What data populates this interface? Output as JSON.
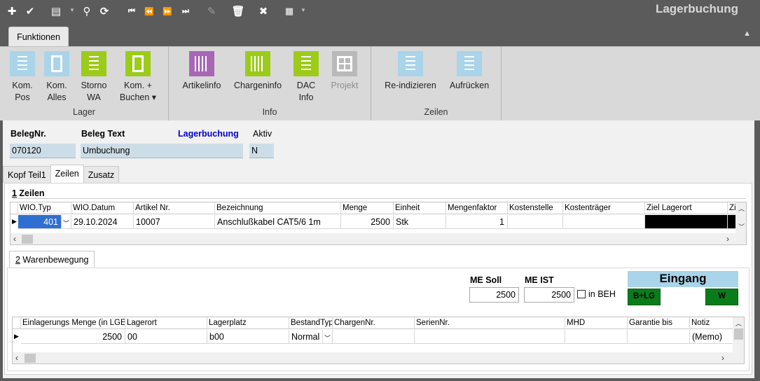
{
  "window": {
    "title": "Lagerbuchung"
  },
  "quick_toolbar": {
    "icons": [
      "plus-icon",
      "check-icon",
      "print-icon",
      "search-icon",
      "refresh-icon",
      "first-record-icon",
      "previous-record-icon",
      "next-record-icon",
      "last-record-icon",
      "edit-icon",
      "delete-icon",
      "close-icon",
      "grid-icon"
    ]
  },
  "ribbon": {
    "active_tab": "Funktionen",
    "groups": [
      {
        "label": "Lager",
        "buttons": [
          {
            "label": "Kom.\nPos",
            "color": "#a9d4ea"
          },
          {
            "label": "Kom.\nAlles",
            "color": "#a9d4ea"
          },
          {
            "label": "Storno\nWA",
            "color": "#9ccb1a"
          },
          {
            "label": "Kom. +\nBuchen ▾",
            "color": "#9ccb1a"
          }
        ]
      },
      {
        "label": "Info",
        "buttons": [
          {
            "label": "Artikelinfo",
            "color": "#a767b5"
          },
          {
            "label": "Chargeninfo",
            "color": "#9ccb1a"
          },
          {
            "label": "DAC\nInfo",
            "color": "#9ccb1a"
          },
          {
            "label": "Projekt",
            "color": "#b9b9b9",
            "disabled": true
          }
        ]
      },
      {
        "label": "Zeilen",
        "buttons": [
          {
            "label": "Re-indizieren",
            "color": "#a9d4ea"
          },
          {
            "label": "Aufrücken",
            "color": "#a9d4ea"
          }
        ]
      }
    ]
  },
  "header": {
    "beleg_nr_label": "BelegNr.",
    "beleg_nr": "070120",
    "beleg_text_label": "Beleg Text",
    "beleg_text": "Umbuchung",
    "type_label": "Lagerbuchung",
    "aktiv_label": "Aktiv",
    "aktiv": "N"
  },
  "tabs": [
    "Kopf Teil1",
    "Zeilen",
    "Zusatz"
  ],
  "active_tab": "Zeilen",
  "zeilen": {
    "section_number": "1",
    "section_label": " Zeilen",
    "columns": [
      "WIO.Typ",
      "WIO.Datum",
      "Artikel Nr.",
      "Bezeichnung",
      "Menge",
      "Einheit",
      "Mengenfaktor",
      "Kostenstelle",
      "Kostenträger",
      "Ziel Lagerort",
      "Zi"
    ],
    "row": [
      "401",
      "29.10.2024",
      "10007",
      "Anschlußkabel CAT5/6 1m",
      "2500",
      "Stk",
      "1",
      "",
      "",
      "",
      ""
    ]
  },
  "warenbewegung": {
    "tab_number": "2",
    "tab_label": " Warenbewegung",
    "me_soll_label": "ME Soll",
    "me_soll": "2500",
    "me_ist_label": "ME IST",
    "me_ist": "2500",
    "in_beh_label": "in BEH",
    "eingang_label": "Eingang",
    "blg_label": "B+LG",
    "w_label": "W",
    "columns": [
      "Einlagerungs Menge (in LGEH)",
      "Lagerort",
      "Lagerplatz",
      "BestandTyp",
      "ChargenNr.",
      "SerienNr.",
      "MHD",
      "Garantie bis",
      "Notiz"
    ],
    "row": [
      "2500",
      "00",
      "b00",
      "Normal",
      "",
      "",
      "",
      "",
      "(Memo)"
    ]
  },
  "colors": {
    "accent_blue": "#0000cc",
    "status_green": "#0a7d1a",
    "eingang_bg": "#a9d4ea"
  }
}
